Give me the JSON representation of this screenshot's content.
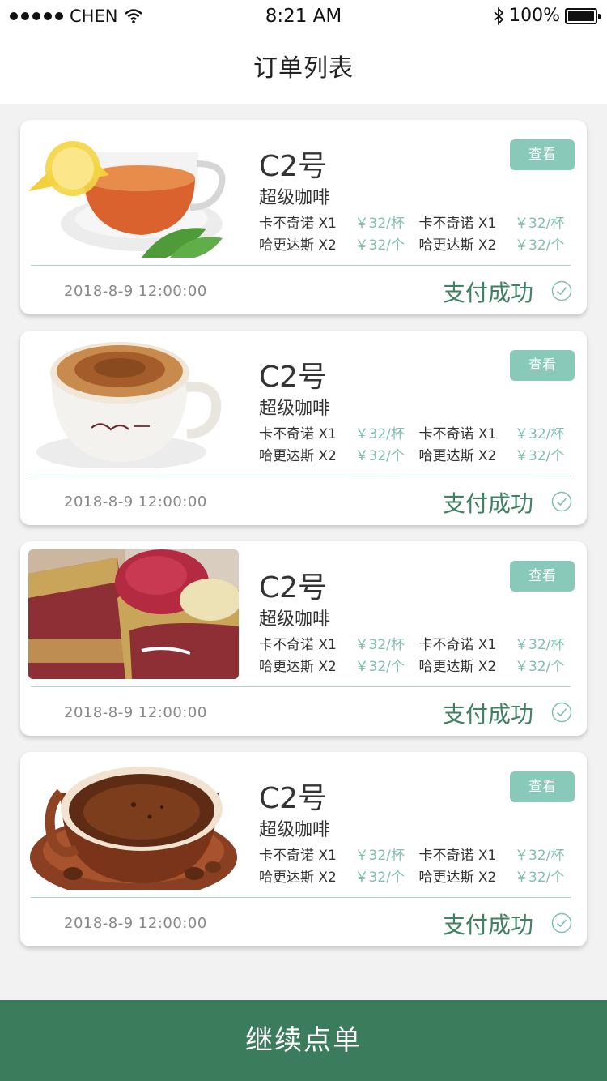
{
  "status_bar": {
    "carrier": "CHEN",
    "time": "8:21 AM",
    "battery": "100%"
  },
  "nav": {
    "title": "订单列表"
  },
  "orders": [
    {
      "image": "tea-cup-image",
      "shop": "C2号",
      "category": "超级咖啡",
      "view_label": "查看",
      "items": [
        [
          {
            "name": "卡不奇诺 X1",
            "price": "￥32/杯"
          },
          {
            "name": "卡不奇诺 X1",
            "price": "￥32/杯"
          }
        ],
        [
          {
            "name": "哈更达斯 X2",
            "price": "￥32/个"
          },
          {
            "name": "哈更达斯 X2",
            "price": "￥32/个"
          }
        ]
      ],
      "time": "2018-8-9 12:00:00",
      "status": "支付成功"
    },
    {
      "image": "cappuccino-cup-image",
      "shop": "C2号",
      "category": "超级咖啡",
      "view_label": "查看",
      "items": [
        [
          {
            "name": "卡不奇诺 X1",
            "price": "￥32/杯"
          },
          {
            "name": "卡不奇诺 X1",
            "price": "￥32/杯"
          }
        ],
        [
          {
            "name": "哈更达斯 X2",
            "price": "￥32/个"
          },
          {
            "name": "哈更达斯 X2",
            "price": "￥32/个"
          }
        ]
      ],
      "time": "2018-8-9 12:00:00",
      "status": "支付成功"
    },
    {
      "image": "ice-cream-image",
      "shop": "C2号",
      "category": "超级咖啡",
      "view_label": "查看",
      "items": [
        [
          {
            "name": "卡不奇诺 X1",
            "price": "￥32/杯"
          },
          {
            "name": "卡不奇诺 X1",
            "price": "￥32/杯"
          }
        ],
        [
          {
            "name": "哈更达斯 X2",
            "price": "￥32/个"
          },
          {
            "name": "哈更达斯 X2",
            "price": "￥32/个"
          }
        ]
      ],
      "time": "2018-8-9 12:00:00",
      "status": "支付成功"
    },
    {
      "image": "coffee-cup-image",
      "shop": "C2号",
      "category": "超级咖啡",
      "view_label": "查看",
      "items": [
        [
          {
            "name": "卡不奇诺 X1",
            "price": "￥32/杯"
          },
          {
            "name": "卡不奇诺 X1",
            "price": "￥32/杯"
          }
        ],
        [
          {
            "name": "哈更达斯 X2",
            "price": "￥32/个"
          },
          {
            "name": "哈更达斯 X2",
            "price": "￥32/个"
          }
        ]
      ],
      "time": "2018-8-9 12:00:00",
      "status": "支付成功"
    }
  ],
  "footer": {
    "continue_label": "继续点单"
  },
  "colors": {
    "accent": "#3b7c5d",
    "view_button": "#88c9ba",
    "price": "#7fbfb0",
    "status": "#3f8263"
  }
}
